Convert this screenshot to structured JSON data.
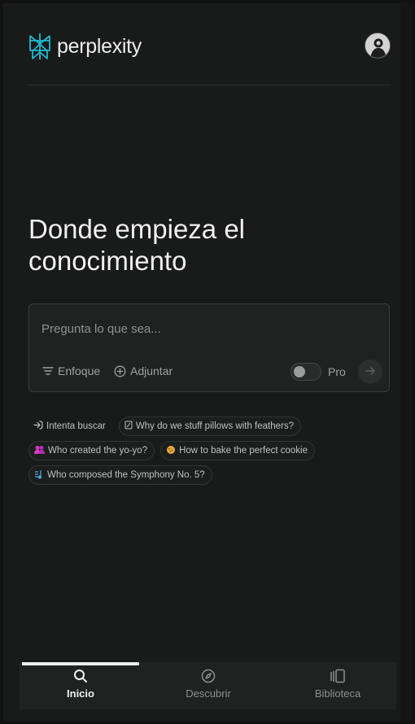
{
  "header": {
    "brand": "perplexity",
    "logo_icon": "perplexity-logo-icon",
    "avatar_icon": "user-avatar"
  },
  "hero": {
    "headline_line1": "Donde empieza el",
    "headline_line2": "conocimiento"
  },
  "composer": {
    "placeholder": "Pregunta lo que sea...",
    "value": "",
    "focus_label": "Enfoque",
    "attach_label": "Adjuntar",
    "pro_label": "Pro",
    "pro_enabled": false,
    "send_icon": "arrow-right-icon"
  },
  "suggestions": {
    "intro": "Intenta buscar",
    "items": [
      {
        "icon": "pillow-icon",
        "text": "Why do we stuff pillows with feathers?"
      },
      {
        "icon": "people-icon",
        "text": "Who created the yo-yo?"
      },
      {
        "icon": "cookie-icon",
        "text": "How to bake the perfect cookie"
      },
      {
        "icon": "music-note-icon",
        "text": "Who composed the Symphony No. 5?"
      }
    ]
  },
  "nav": {
    "items": [
      {
        "label": "Inicio",
        "icon": "search-icon",
        "active": true
      },
      {
        "label": "Descubrir",
        "icon": "compass-icon",
        "active": false
      },
      {
        "label": "Biblioteca",
        "icon": "library-icon",
        "active": false
      }
    ]
  },
  "colors": {
    "background": "#191a1a",
    "accent": "#20b8cd",
    "surface": "#202222",
    "text": "#e8e8e6",
    "muted": "#8d9191"
  }
}
